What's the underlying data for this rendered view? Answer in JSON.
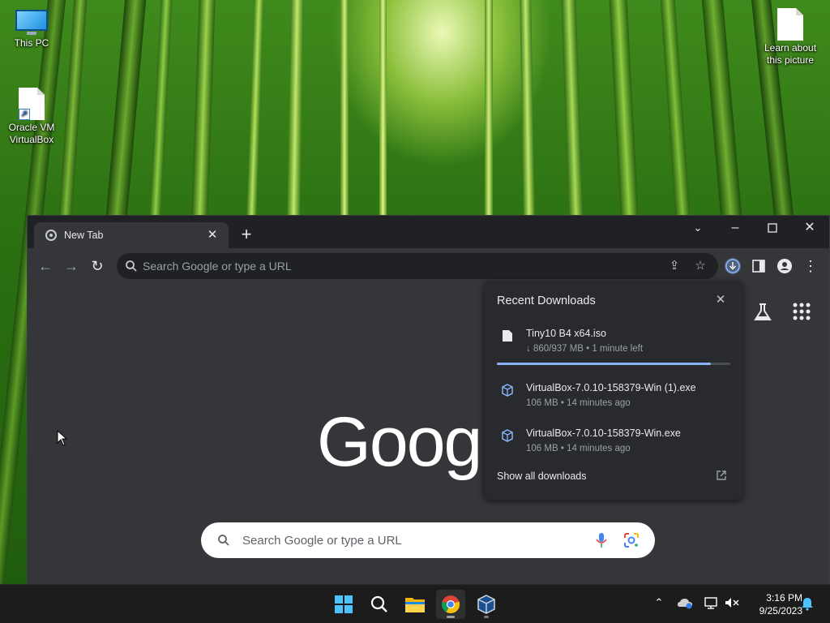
{
  "desktop": {
    "icons": [
      {
        "label": "This PC",
        "icon": "computer-icon"
      },
      {
        "label": "Oracle VM VirtualBox",
        "icon": "file-shortcut-icon"
      },
      {
        "label": "Learn about this picture",
        "icon": "file-icon"
      }
    ]
  },
  "browser": {
    "tab_title": "New Tab",
    "omnibox_placeholder": "Search Google or type a URL",
    "ntp": {
      "logo_text": "Google",
      "search_placeholder": "Search Google or type a URL"
    }
  },
  "downloads": {
    "heading": "Recent Downloads",
    "items": [
      {
        "name": "Tiny10 B4 x64.iso",
        "meta": "↓ 860/937 MB • 1 minute left",
        "icon": "file-icon",
        "progress": 0.918
      },
      {
        "name": "VirtualBox-7.0.10-158379-Win (1).exe",
        "meta": "106 MB • 14 minutes ago",
        "icon": "virtualbox-icon"
      },
      {
        "name": "VirtualBox-7.0.10-158379-Win.exe",
        "meta": "106 MB • 14 minutes ago",
        "icon": "virtualbox-icon"
      }
    ],
    "show_all": "Show all downloads"
  },
  "taskbar": {
    "apps": [
      "start-icon",
      "search-icon",
      "file-explorer-icon",
      "chrome-icon",
      "virtualbox-icon"
    ],
    "time": "3:16 PM",
    "date": "9/25/2023"
  },
  "colors": {
    "accent": "#8ab4f8",
    "chrome_bg": "#35363a",
    "bubble_bg": "#292a2d"
  }
}
